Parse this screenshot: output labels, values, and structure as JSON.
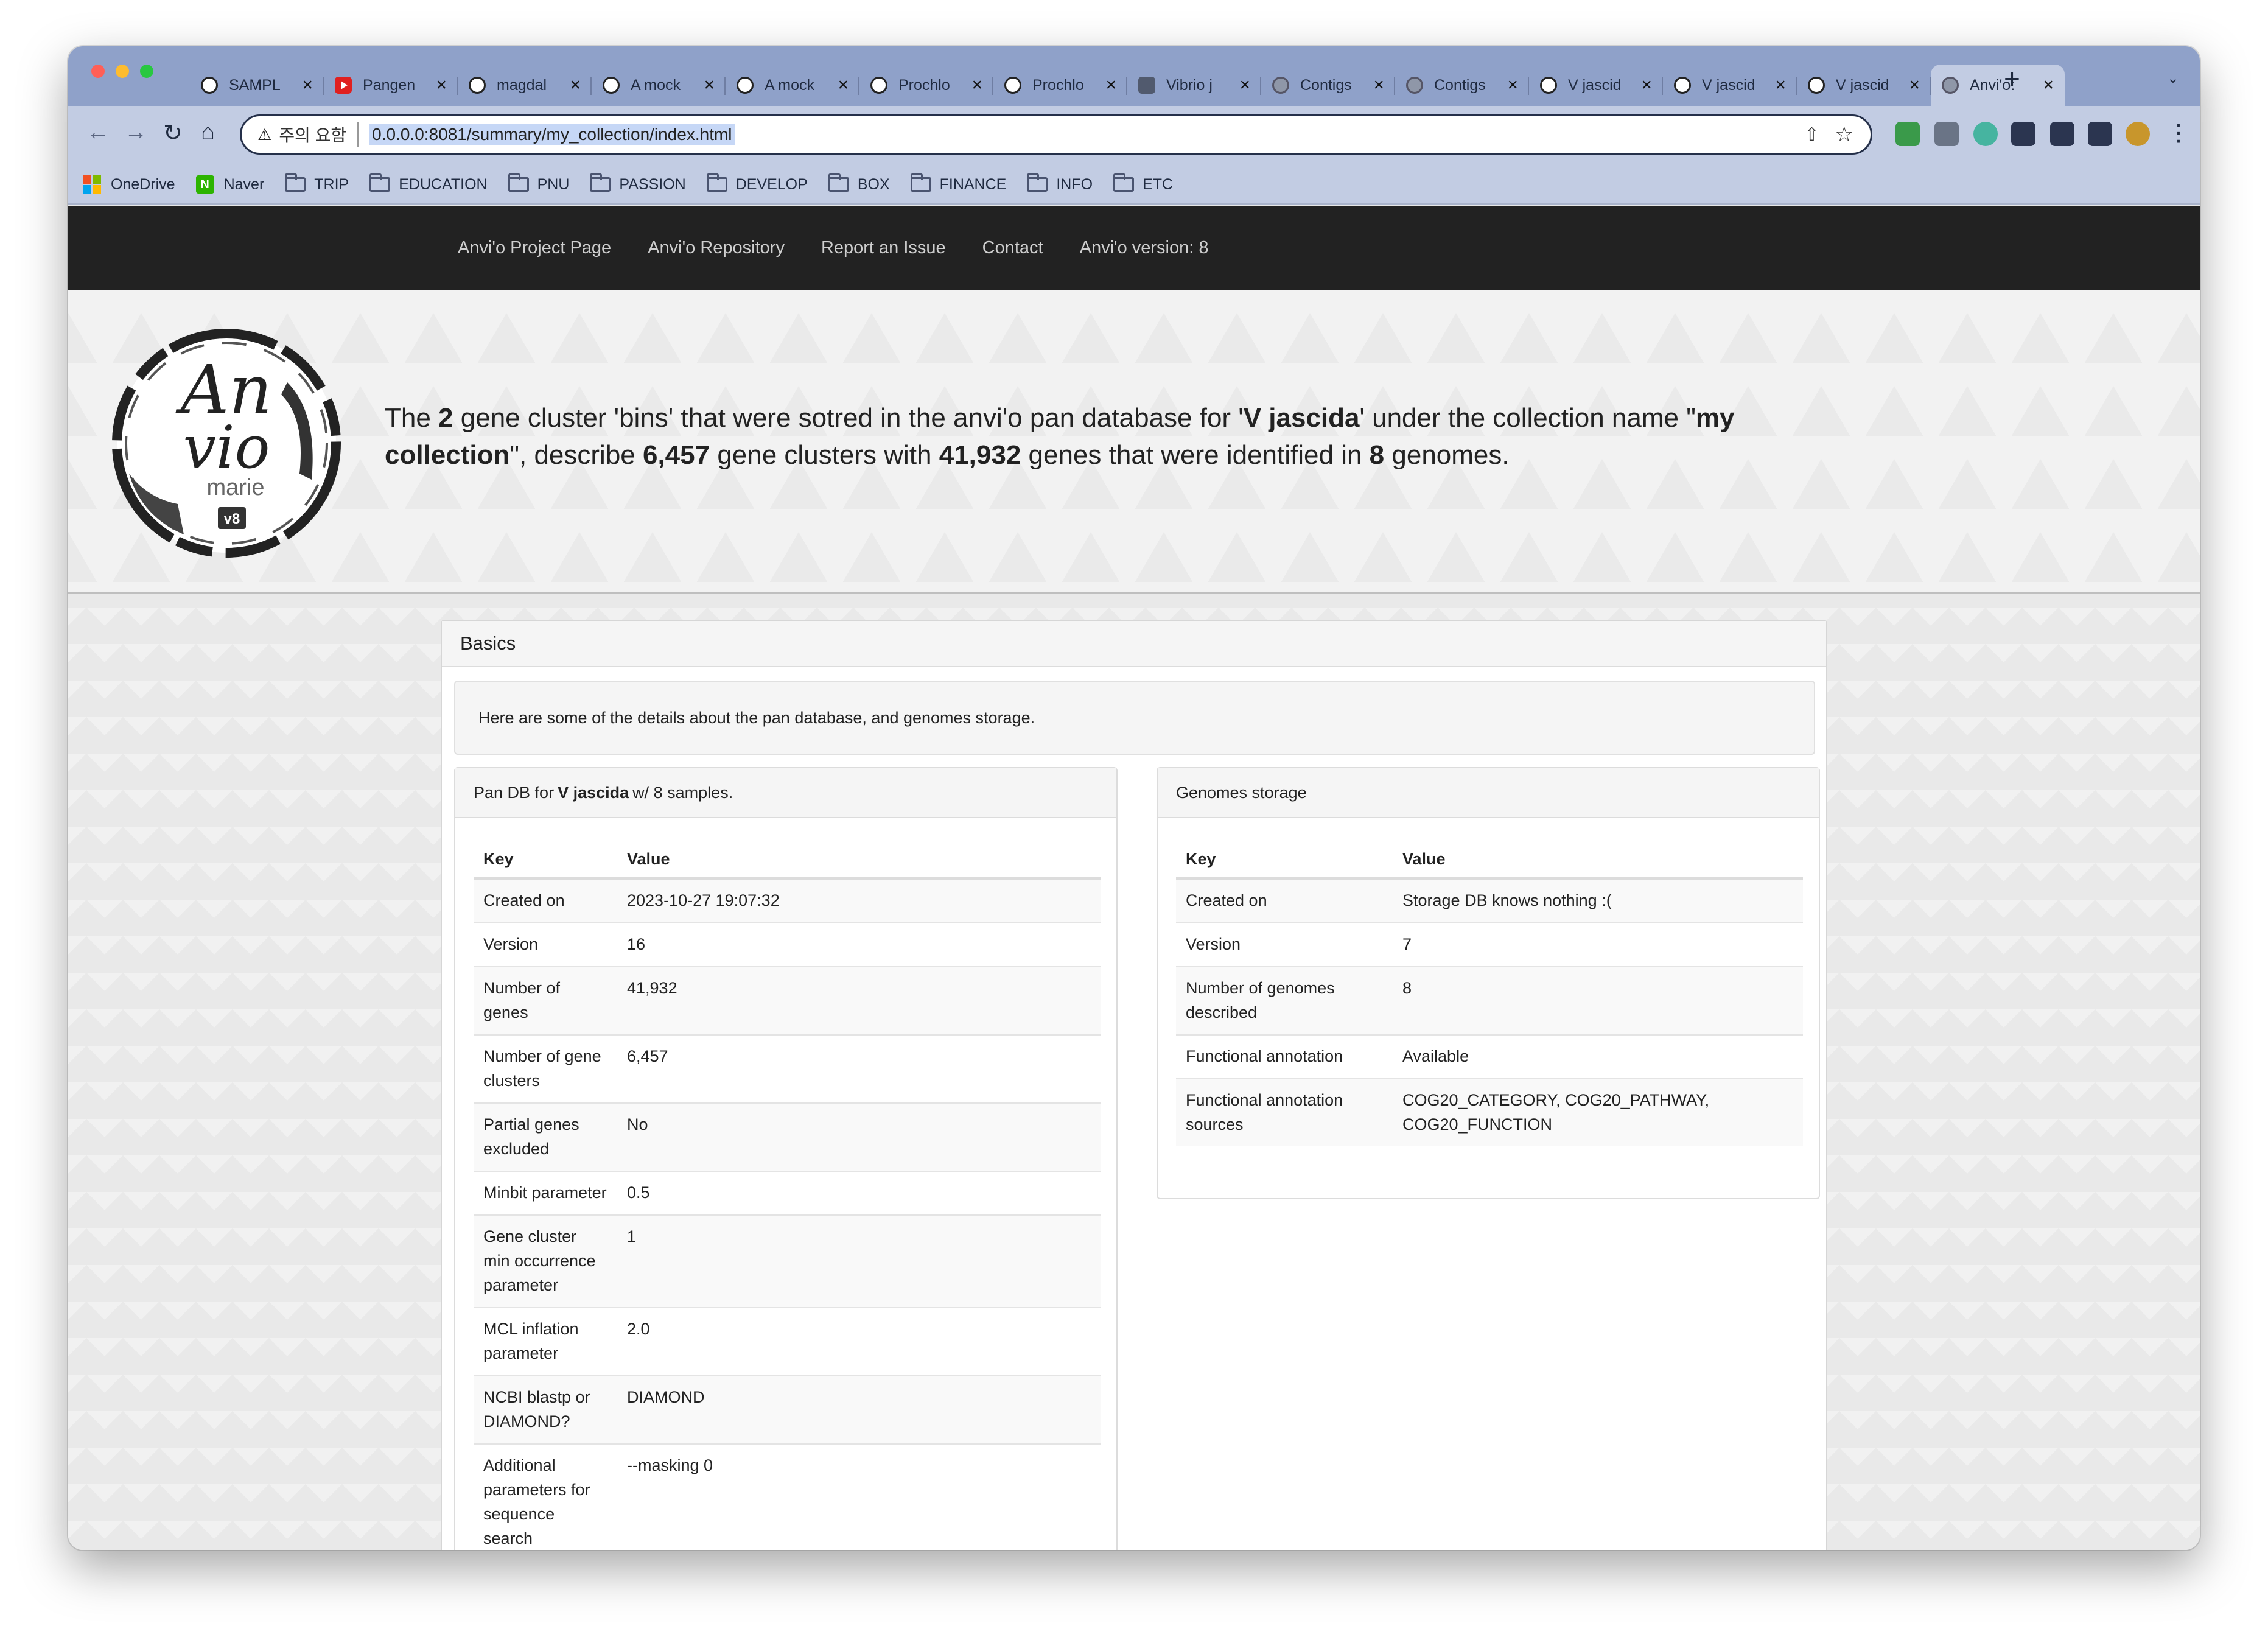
{
  "browser": {
    "tabs": [
      {
        "label": "SAMPL",
        "icon": "github-icon"
      },
      {
        "label": "Pangen",
        "icon": "youtube-icon"
      },
      {
        "label": "magdal",
        "icon": "github-icon"
      },
      {
        "label": "A mock",
        "icon": "github-icon"
      },
      {
        "label": "A mock",
        "icon": "github-icon"
      },
      {
        "label": "Prochlo",
        "icon": "github-icon"
      },
      {
        "label": "Prochlo",
        "icon": "github-icon"
      },
      {
        "label": "Vibrio j",
        "icon": "page-icon"
      },
      {
        "label": "Contigs",
        "icon": "globe-icon"
      },
      {
        "label": "Contigs",
        "icon": "globe-icon"
      },
      {
        "label": "V jascid",
        "icon": "github-icon"
      },
      {
        "label": "V jascid",
        "icon": "github-icon"
      },
      {
        "label": "V jascid",
        "icon": "github-icon"
      },
      {
        "label": "Anvi'o:",
        "icon": "globe-icon",
        "active": true
      }
    ],
    "security_label": "주의 요함",
    "url": "0.0.0.0:8081/summary/my_collection/index.html",
    "bookmarks": [
      "OneDrive",
      "Naver",
      "TRIP",
      "EDUCATION",
      "PNU",
      "PASSION",
      "DEVELOP",
      "BOX",
      "FINANCE",
      "INFO",
      "ETC"
    ]
  },
  "navbar": {
    "links": [
      "Anvi'o Project Page",
      "Anvi'o Repository",
      "Report an Issue",
      "Contact",
      "Anvi'o version: 8"
    ]
  },
  "logo": {
    "text": "An vio",
    "subtitle": "marie",
    "badge": "v8"
  },
  "hero": {
    "p1": "The ",
    "bins_count": "2",
    "p2": " gene cluster 'bins' that were sotred in the anvi'o pan database for '",
    "project": "V jascida",
    "p3": "' under the collection name \"",
    "collection": "my collection",
    "p4": "\", describe ",
    "gene_clusters": "6,457",
    "p5": " gene clusters with ",
    "genes": "41,932",
    "p6": " genes that were identified in ",
    "genomes": "8",
    "p7": " genomes."
  },
  "basics": {
    "title": "Basics",
    "description": "Here are some of the details about the pan database, and genomes storage.",
    "pan": {
      "head_prefix": "Pan DB for ",
      "head_name": "V jascida",
      "head_suffix": " w/ 8 samples.",
      "col_key": "Key",
      "col_value": "Value",
      "rows": [
        {
          "key": "Created on",
          "value": "2023-10-27 19:07:32"
        },
        {
          "key": "Version",
          "value": "16"
        },
        {
          "key": "Number of genes",
          "value": "41,932"
        },
        {
          "key": "Number of gene clusters",
          "value": "6,457"
        },
        {
          "key": "Partial genes excluded",
          "value": "No"
        },
        {
          "key": "Minbit parameter",
          "value": "0.5"
        },
        {
          "key": "Gene cluster min occurrence parameter",
          "value": "1"
        },
        {
          "key": "MCL inflation parameter",
          "value": "2.0"
        },
        {
          "key": "NCBI blastp or DIAMOND?",
          "value": "DIAMOND"
        },
        {
          "key": "Additional parameters for sequence search",
          "value": "--masking 0"
        }
      ]
    },
    "storage": {
      "head": "Genomes storage",
      "col_key": "Key",
      "col_value": "Value",
      "rows": [
        {
          "key": "Created on",
          "value": "Storage DB knows nothing :("
        },
        {
          "key": "Version",
          "value": "7"
        },
        {
          "key": "Number of genomes described",
          "value": "8"
        },
        {
          "key": "Functional annotation",
          "value": "Available"
        },
        {
          "key": "Functional annotation sources",
          "value": "COG20_CATEGORY, COG20_PATHWAY, COG20_FUNCTION"
        }
      ]
    }
  }
}
